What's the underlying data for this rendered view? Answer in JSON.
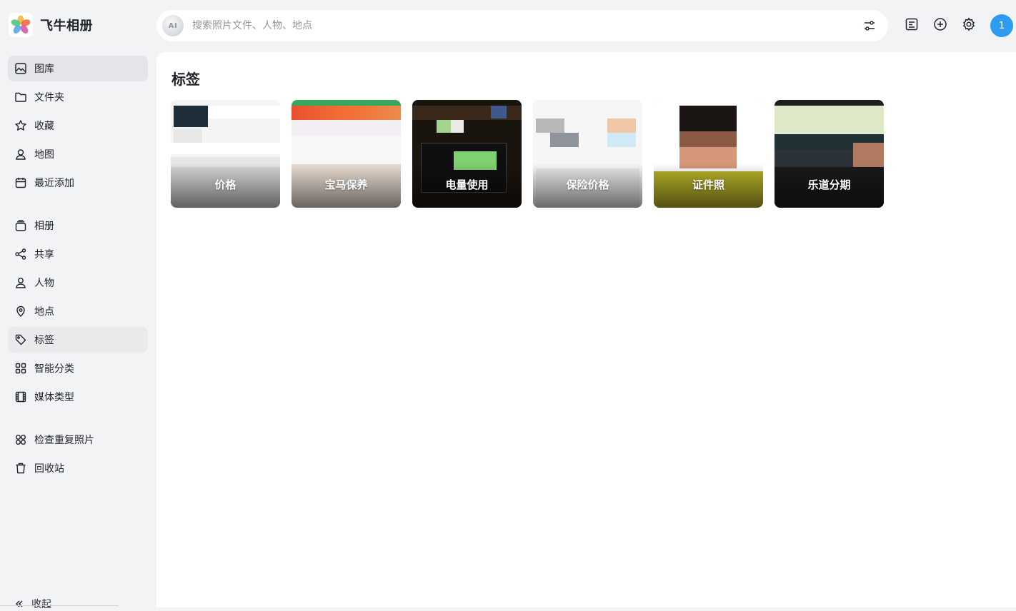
{
  "app": {
    "name": "飞牛相册"
  },
  "search": {
    "placeholder": "搜索照片文件、人物、地点",
    "ai_badge": "AI"
  },
  "user": {
    "avatar_text": "1",
    "avatar_color": "#2d9bf0"
  },
  "sidebar": {
    "group1": [
      {
        "label": "图库",
        "icon": "gallery-icon",
        "active": true
      },
      {
        "label": "文件夹",
        "icon": "folder-icon"
      },
      {
        "label": "收藏",
        "icon": "star-icon"
      },
      {
        "label": "地图",
        "icon": "map-icon"
      },
      {
        "label": "最近添加",
        "icon": "calendar-icon"
      }
    ],
    "group2": [
      {
        "label": "相册",
        "icon": "album-icon"
      },
      {
        "label": "共享",
        "icon": "share-icon"
      },
      {
        "label": "人物",
        "icon": "person-icon"
      },
      {
        "label": "地点",
        "icon": "location-icon"
      },
      {
        "label": "标签",
        "icon": "tag-icon",
        "selected": true
      },
      {
        "label": "智能分类",
        "icon": "grid-icon"
      },
      {
        "label": "媒体类型",
        "icon": "film-icon"
      }
    ],
    "group3": [
      {
        "label": "检查重复照片",
        "icon": "duplicate-icon"
      },
      {
        "label": "回收站",
        "icon": "trash-icon"
      }
    ],
    "collapse_label": "收起"
  },
  "main": {
    "title": "标签",
    "tags": [
      {
        "label": "价格"
      },
      {
        "label": "宝马保养"
      },
      {
        "label": "电量使用"
      },
      {
        "label": "保险价格"
      },
      {
        "label": "证件照"
      },
      {
        "label": "乐道分期"
      }
    ]
  }
}
